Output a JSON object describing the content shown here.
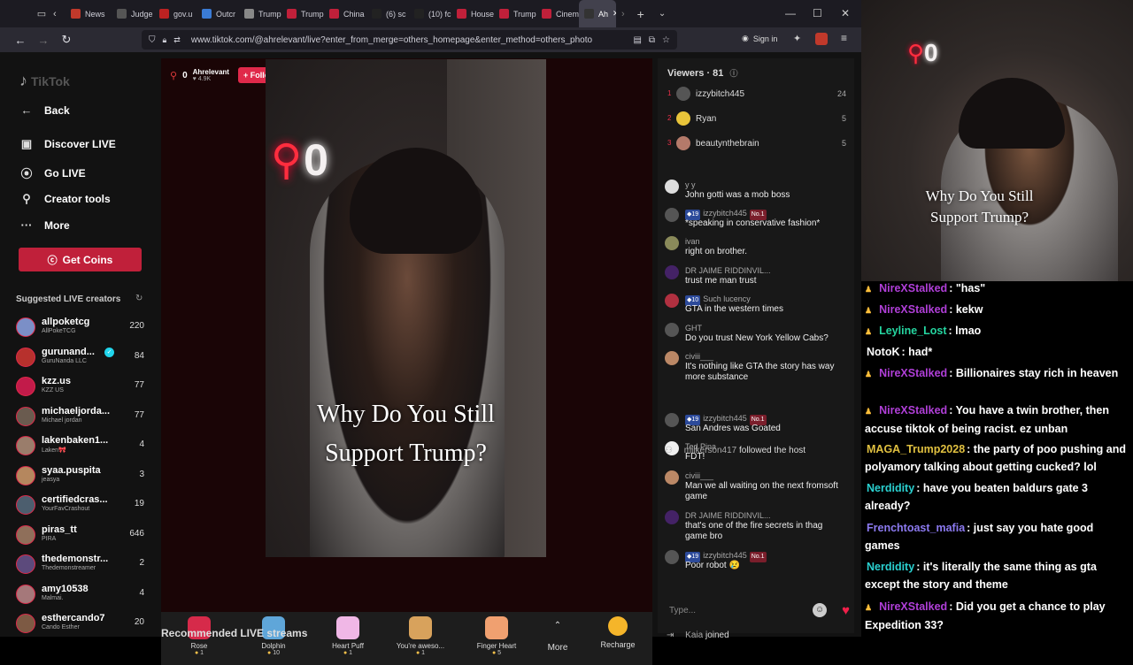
{
  "browser": {
    "tabs": [
      "News",
      "Judge",
      "gov.u",
      "Outcr",
      "Trump",
      "Trump",
      "China",
      "(6) sc",
      "(10) fc",
      "House",
      "Trump",
      "Cinem",
      "Ah"
    ],
    "url": "www.tiktok.com/@ahrelevant/live?enter_from_merge=others_homepage&enter_method=others_photo",
    "sign_in": "Sign in"
  },
  "sidebar": {
    "logo": "TikTok",
    "nav": [
      {
        "label": "Back",
        "icon": "back-arrow-icon"
      },
      {
        "label": "Discover LIVE",
        "icon": "discover-icon"
      },
      {
        "label": "Go LIVE",
        "icon": "camera-icon"
      },
      {
        "label": "Creator tools",
        "icon": "lightbulb-icon"
      },
      {
        "label": "More",
        "icon": "dots-icon"
      }
    ],
    "coins_label": "Get Coins",
    "suggested_title": "Suggested LIVE creators",
    "creators": [
      {
        "name": "allpoketcg",
        "sub": "AllPokeTCG",
        "count": "220",
        "color": "#7b8fc7"
      },
      {
        "name": "gurunand...",
        "sub": "GuruNanda LLC",
        "count": "84",
        "color": "#b7312d"
      },
      {
        "name": "kzz.us",
        "sub": "KZZ US",
        "count": "77",
        "color": "#c21b4a"
      },
      {
        "name": "michaeljorda...",
        "sub": "Michael jordan",
        "count": "77",
        "color": "#6a5b4f"
      },
      {
        "name": "lakenbaken1...",
        "sub": "Laken🎀",
        "count": "4",
        "color": "#9a7d6b"
      },
      {
        "name": "syaa.puspita",
        "sub": "jeasya",
        "count": "3",
        "color": "#b5875e"
      },
      {
        "name": "certifiedcras...",
        "sub": "YourFavCrashout",
        "count": "19",
        "color": "#4c5e6e"
      },
      {
        "name": "piras_tt",
        "sub": "PIRA",
        "count": "646",
        "color": "#8f6f5a"
      },
      {
        "name": "thedemonstr...",
        "sub": "Thedemonstreamer",
        "count": "2",
        "color": "#5c4a7c"
      },
      {
        "name": "amy10538",
        "sub": "Malmai.",
        "count": "4",
        "color": "#a5787a"
      },
      {
        "name": "esthercando7",
        "sub": "Cando Esther",
        "count": "20",
        "color": "#7d5a44"
      }
    ]
  },
  "stream": {
    "host": "Ahrelevant",
    "likes": "4.9K",
    "follow_label": "+ Follow",
    "caption_line1": "Why Do You Still",
    "caption_line2": "Support Trump?",
    "neon": "0",
    "recommended": "Recommended LIVE streams"
  },
  "gifts": [
    {
      "name": "Rose",
      "cost": "1",
      "color": "#d62a4a"
    },
    {
      "name": "Dolphin",
      "cost": "10",
      "color": "#5fa6d9"
    },
    {
      "name": "Heart Puff",
      "cost": "1",
      "color": "#f0b7e6"
    },
    {
      "name": "You're aweso...",
      "cost": "1",
      "color": "#d8a25c"
    },
    {
      "name": "Finger Heart",
      "cost": "5",
      "color": "#f0a070"
    }
  ],
  "gift_more": "More",
  "recharge": "Recharge",
  "viewers": {
    "title": "Viewers · 81",
    "top": [
      {
        "rank": "1",
        "name": "izzybitch445",
        "score": "24"
      },
      {
        "rank": "2",
        "name": "Ryan",
        "score": "5"
      },
      {
        "rank": "3",
        "name": "beautynthebrain",
        "score": "5"
      }
    ]
  },
  "chat": [
    {
      "user": "y y",
      "text": "John gotti was a mob boss",
      "lvl": "",
      "no1": ""
    },
    {
      "user": "izzybitch445",
      "text": "*speaking in conservative fashion*",
      "lvl": "19",
      "no1": "No.1"
    },
    {
      "user": "ivan",
      "text": "right on brother.",
      "lvl": "",
      "no1": ""
    },
    {
      "user": "DR JAIME RIDDINVIL...",
      "text": "trust me man trust",
      "lvl": "",
      "no1": ""
    },
    {
      "user": "Such lucency",
      "text": "GTA in the western times",
      "lvl": "10",
      "no1": ""
    },
    {
      "user": "GHT",
      "text": "Do you trust New York Yellow Cabs?",
      "lvl": "",
      "no1": ""
    },
    {
      "user": "civiii___",
      "text": "It's nothing like GTA the story has way more substance",
      "lvl": "",
      "no1": ""
    },
    {
      "user": "izzybitch445",
      "text": "San Andres was Goated",
      "lvl": "19",
      "no1": "No.1"
    },
    {
      "user": "Ted Pina",
      "text": "FDT!",
      "lvl": "",
      "no1": ""
    },
    {
      "user": "civiii___",
      "text": "Man we all waiting on the next fromsoft game",
      "lvl": "",
      "no1": ""
    },
    {
      "user": "DR JAIME RIDDINVIL...",
      "text": "that's one of the fire secrets in thag game bro",
      "lvl": "",
      "no1": ""
    },
    {
      "user": "izzybitch445",
      "text": "Poor robot 😢",
      "lvl": "19",
      "no1": "No.1"
    }
  ],
  "follow_event": {
    "user": "milkerson417",
    "text": "followed the host"
  },
  "join_event": {
    "user": "Kaia",
    "text": "joined"
  },
  "chat_placeholder": "Type...",
  "twitch": {
    "overlay_count": "0",
    "caption_line1": "Why Do You Still",
    "caption_line2": "Support Trump?",
    "messages": [
      {
        "user": "NireXStalked",
        "text": ": \"has\"",
        "color": "#b03fd8"
      },
      {
        "user": "NireXStalked",
        "text": ": kekw",
        "color": "#b03fd8"
      },
      {
        "user": "Leyline_Lost",
        "text": ": lmao",
        "color": "#25d5a0"
      },
      {
        "user": "NotoK",
        "text": ": had*",
        "color": "#ffffff"
      },
      {
        "user": "NireXStalked",
        "text": ": Billionaires stay rich in heaven",
        "color": "#b03fd8"
      },
      {
        "user": "NireXStalked",
        "text": ": You have a twin brother, then accuse tiktok of being racist. ez unban",
        "color": "#b03fd8"
      },
      {
        "user": "MAGA_Trump2028",
        "text": ": the party of poo pushing and polyamory talking about getting cucked? lol",
        "color": "#e0c040"
      },
      {
        "user": "Nerdidity",
        "text": ": have you beaten baldurs gate 3 already?",
        "color": "#2ad0d0"
      },
      {
        "user": "Frenchtoast_mafia",
        "text": ": just say you hate good games",
        "color": "#8c7af0"
      },
      {
        "user": "Nerdidity",
        "text": ": it's literally the same thing as gta except the story and theme",
        "color": "#2ad0d0"
      },
      {
        "user": "NireXStalked",
        "text": ": Did you get a chance to play Expedition 33?",
        "color": "#b03fd8"
      }
    ]
  }
}
